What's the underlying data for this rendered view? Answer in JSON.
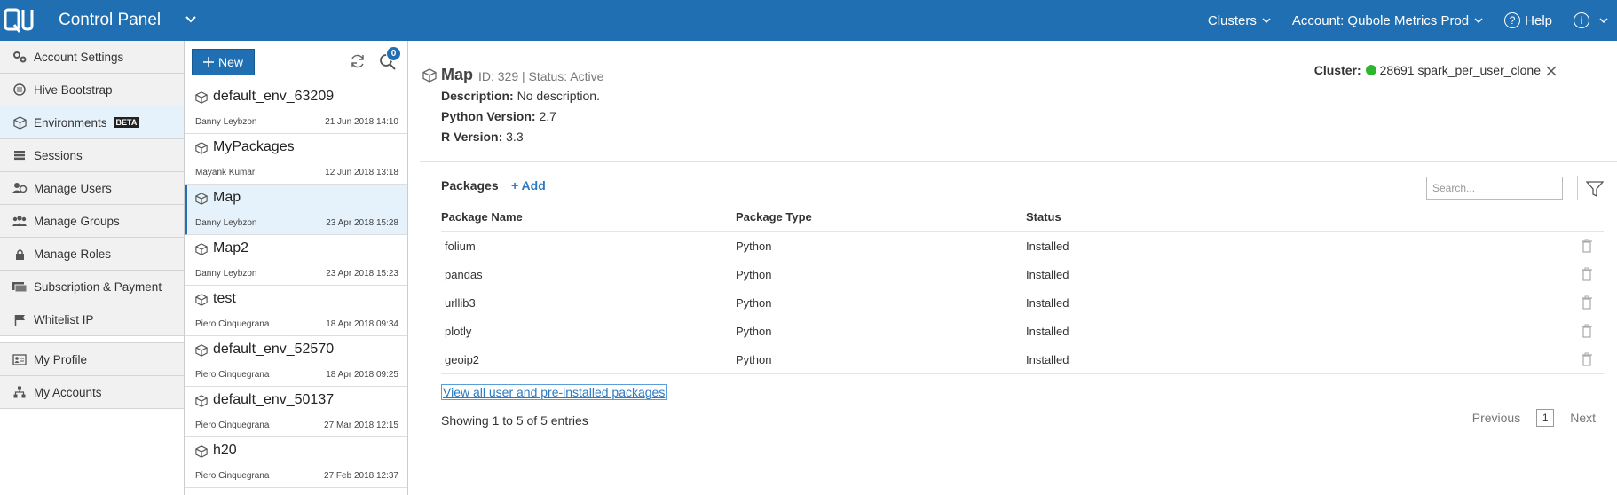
{
  "header": {
    "logo_text": "Qu",
    "title": "Control Panel",
    "clusters_label": "Clusters",
    "account_label": "Account: Qubole Metrics Prod",
    "help_label": "Help"
  },
  "sidebar": {
    "items": [
      {
        "label": "Account Settings",
        "icon": "gears-icon"
      },
      {
        "label": "Hive Bootstrap",
        "icon": "bootstrap-icon"
      },
      {
        "label": "Environments",
        "icon": "cube-icon",
        "badge": "BETA",
        "active": true
      },
      {
        "label": "Sessions",
        "icon": "sessions-icon"
      },
      {
        "label": "Manage Users",
        "icon": "users-icon"
      },
      {
        "label": "Manage Groups",
        "icon": "groups-icon"
      },
      {
        "label": "Manage Roles",
        "icon": "lock-icon"
      },
      {
        "label": "Subscription & Payment",
        "icon": "payment-icon"
      },
      {
        "label": "Whitelist IP",
        "icon": "flag-icon"
      }
    ],
    "bottom_items": [
      {
        "label": "My Profile",
        "icon": "profile-icon"
      },
      {
        "label": "My Accounts",
        "icon": "accounts-icon"
      }
    ]
  },
  "envlist": {
    "new_label": "New",
    "badge_count": "0",
    "items": [
      {
        "name": "default_env_63209",
        "user": "Danny Leybzon",
        "date": "21 Jun 2018 14:10"
      },
      {
        "name": "MyPackages",
        "user": "Mayank Kumar",
        "date": "12 Jun 2018 13:18"
      },
      {
        "name": "Map",
        "user": "Danny Leybzon",
        "date": "23 Apr 2018 15:28",
        "selected": true
      },
      {
        "name": "Map2",
        "user": "Danny Leybzon",
        "date": "23 Apr 2018 15:23"
      },
      {
        "name": "test",
        "user": "Piero Cinquegrana",
        "date": "18 Apr 2018 09:34"
      },
      {
        "name": "default_env_52570",
        "user": "Piero Cinquegrana",
        "date": "18 Apr 2018 09:25"
      },
      {
        "name": "default_env_50137",
        "user": "Piero Cinquegrana",
        "date": "27 Mar 2018 12:15"
      },
      {
        "name": "h20",
        "user": "Piero Cinquegrana",
        "date": "27 Feb 2018 12:37"
      }
    ]
  },
  "detail": {
    "name": "Map",
    "meta": "ID: 329  | Status: Active",
    "description_label": "Description:",
    "description": "No description.",
    "python_label": "Python Version:",
    "python": "2.7",
    "r_label": "R Version:",
    "r": "3.3",
    "cluster_label": "Cluster:",
    "cluster_value": "28691 spark_per_user_clone",
    "cluster_status_color": "#2db52d"
  },
  "packages": {
    "title": "Packages",
    "add_label": "+ Add",
    "search_placeholder": "Search...",
    "columns": [
      "Package Name",
      "Package Type",
      "Status"
    ],
    "rows": [
      {
        "name": "folium",
        "type": "Python",
        "status": "Installed"
      },
      {
        "name": "pandas",
        "type": "Python",
        "status": "Installed"
      },
      {
        "name": "urllib3",
        "type": "Python",
        "status": "Installed"
      },
      {
        "name": "plotly",
        "type": "Python",
        "status": "Installed"
      },
      {
        "name": "geoip2",
        "type": "Python",
        "status": "Installed"
      }
    ],
    "view_all": "View all user and pre-installed packages",
    "showing": "Showing 1 to 5 of 5 entries",
    "previous": "Previous",
    "page": "1",
    "next": "Next"
  },
  "colors": {
    "brand": "#1f6fb2",
    "link": "#2b7bc2",
    "selected_bg": "#e6f2fb"
  }
}
